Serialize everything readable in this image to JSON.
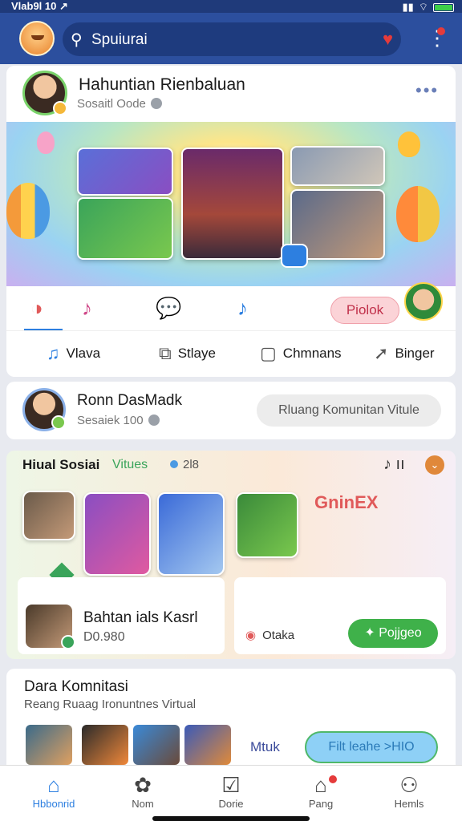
{
  "status": {
    "time": "Vlab9l 10 ↗",
    "signal": "▮▮",
    "wifi": "⌔"
  },
  "header": {
    "search_text": "Spuiurai",
    "search_icon": "search-icon",
    "heart_icon": "heart-icon",
    "menu_icon": "kebab-menu-icon"
  },
  "post": {
    "author": "Hahuntian Rienbaluan",
    "subtitle": "Sosaitl Oode",
    "more": "•••",
    "reactions": [
      "◑",
      "♪",
      "💬",
      "♪"
    ],
    "pill_label": "Piolok",
    "actions": [
      {
        "icon": "♫",
        "label": "Vlava"
      },
      {
        "icon": "⧉",
        "label": "Stlaye"
      },
      {
        "icon": "▢",
        "label": "Chmnans"
      },
      {
        "icon": "➚",
        "label": "Binger"
      }
    ]
  },
  "community": {
    "name": "Ronn DasMadk",
    "subtitle": "Sesaiek 100",
    "button": "Rluang Komunitan Vitule"
  },
  "virtual": {
    "title": "Hiual Sosiai",
    "tag": "Vitues",
    "meta": "2l8",
    "icons": "♪ ıı",
    "chevron": "⌄",
    "item_title": "Bahtan ials Kasrl",
    "item_value": "D0.980",
    "brand": "GninEX",
    "tag2": "Otaka",
    "button": "✦ Pojjgeo"
  },
  "community2": {
    "title": "Dara Komnitasi",
    "subtitle": "Reang Ruaag Ironuntnes Virtual",
    "link": "Mtuk",
    "button": "Filt leahe >HIO"
  },
  "nav": [
    {
      "icon": "⌂",
      "label": "Hbbonrid",
      "active": true
    },
    {
      "icon": "✿",
      "label": "Nom"
    },
    {
      "icon": "☑",
      "label": "Dorie"
    },
    {
      "icon": "⌂",
      "label": "Pang"
    },
    {
      "icon": "⚇",
      "label": "Hemls"
    }
  ],
  "colors": {
    "header": "#2c4f9e",
    "accent": "#2d7fe0",
    "success": "#3fb14a"
  }
}
